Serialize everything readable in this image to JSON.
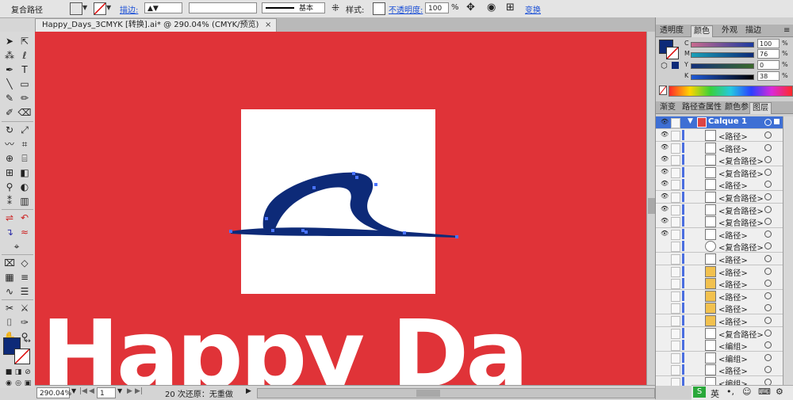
{
  "controlbar": {
    "object_type": "复合路径",
    "stroke_label": "描边:",
    "stroke_profile": "基本",
    "style_label": "样式:",
    "opacity_label": "不透明度:",
    "opacity_value": "100",
    "opacity_unit": "%",
    "transform_label": "变换",
    "fill_color": "#0d2a78"
  },
  "document": {
    "tab_title": "Happy_Days_3CMYK [转换].ai* @ 290.04% (CMYK/预览)",
    "big_text": "Happy Da",
    "artboard_color": "#e03338",
    "artwork_color": "#0d2a78"
  },
  "statusbar": {
    "zoom": "290.04%",
    "page": "1",
    "undo_status": "20 次还原：无重做"
  },
  "color_panel": {
    "tabs": [
      "透明度",
      "颜色",
      "外观",
      "描边"
    ],
    "channels": [
      {
        "label": "C",
        "value": "100",
        "unit": "%"
      },
      {
        "label": "M",
        "value": "76",
        "unit": "%"
      },
      {
        "label": "Y",
        "value": "0",
        "unit": "%"
      },
      {
        "label": "K",
        "value": "38",
        "unit": "%"
      }
    ]
  },
  "layers_panel": {
    "tabs": [
      "渐变",
      "路径查",
      "属性",
      "颜色参",
      "图层"
    ],
    "layer_name": "Calque 1",
    "items": [
      "<路径>",
      "<路径>",
      "<复合路径>",
      "<复合路径>",
      "<路径>",
      "<复合路径>",
      "<复合路径>",
      "<复合路径>",
      "<路径>",
      "<复合路径>",
      "<路径>",
      "<路径>",
      "<路径>",
      "<路径>",
      "<路径>",
      "<路径>",
      "<复合路径>",
      "<编组>",
      "<编组>",
      "<路径>",
      "<编组>"
    ]
  },
  "taskbar": {
    "ime_label": "英"
  }
}
